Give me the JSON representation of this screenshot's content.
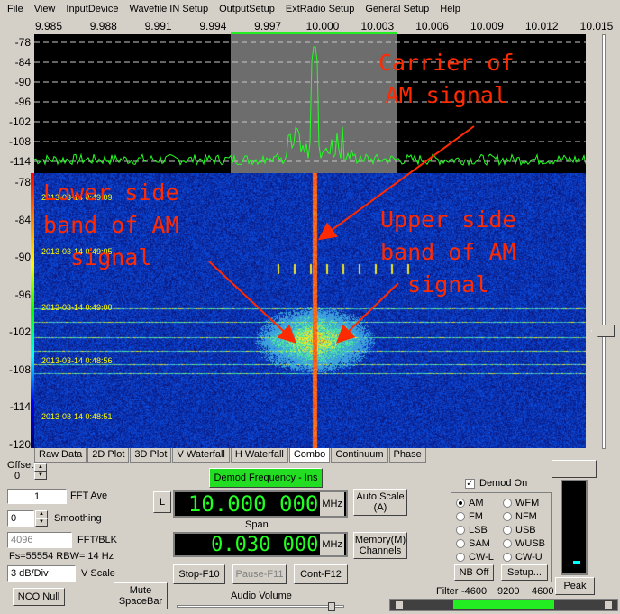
{
  "menu": [
    "File",
    "View",
    "InputDevice",
    "Wavefile IN Setup",
    "OutputSetup",
    "ExtRadio Setup",
    "General Setup",
    "Help"
  ],
  "freq_axis": [
    "9.985",
    "9.988",
    "9.991",
    "9.994",
    "9.997",
    "10.000",
    "10.003",
    "10.006",
    "10.009",
    "10.012",
    "10.015"
  ],
  "spectrum_db_axis": [
    "-78",
    "-84",
    "-90",
    "-96",
    "-102",
    "-108",
    "-114"
  ],
  "waterfall_db_axis": [
    "-78",
    "-84",
    "-90",
    "-96",
    "-102",
    "-108",
    "-114",
    "-120"
  ],
  "timestamps": [
    "2013-03-14 0:49:09",
    "2013-03-14 0:49:05",
    "2013-03-14 0:49:00",
    "2013-03-14 0:48:56",
    "2013-03-14 0:48:51"
  ],
  "annotations": {
    "carrier": "Carrier of\nAM signal",
    "lower": "Lower side\nband of AM\nsignal",
    "upper": "Upper side\nband of AM\nsignal"
  },
  "tabs": [
    "Raw Data",
    "2D Plot",
    "3D Plot",
    "V Waterfall",
    "H Waterfall",
    "Combo",
    "Continuum",
    "Phase"
  ],
  "active_tab": "Combo",
  "controls": {
    "offset_label": "Offset",
    "offset_value": "0",
    "fft_ave_value": "1",
    "fft_ave_label": "FFT Ave",
    "smoothing_value": "0",
    "smoothing_label": "Smoothing",
    "fft_blk_value": "4096",
    "fft_blk_label": "FFT/BLK",
    "fs_info": "Fs=55554 RBW= 14 Hz",
    "vscale_value": "3 dB/Div",
    "vscale_label": "V Scale",
    "nco_null": "NCO Null",
    "mute": "Mute\nSpaceBar",
    "demod_freq_button": "Demod Frequency - Ins",
    "l_button": "L",
    "demod_freq": "10.000 000",
    "freq_unit": "MHz",
    "auto_scale": "Auto Scale\n(A)",
    "span_label": "Span",
    "span_value": "0.030 000",
    "span_unit": "MHz",
    "memory": "Memory(M)\nChannels",
    "stop": "Stop-F10",
    "pause": "Pause-F11",
    "cont": "Cont-F12",
    "audio_volume": "Audio Volume",
    "demod_on": "Demod On",
    "demod_on_checked": "✓",
    "modes": [
      "AM",
      "WFM",
      "FM",
      "NFM",
      "LSB",
      "USB",
      "SAM",
      "WUSB",
      "CW-L",
      "CW-U"
    ],
    "selected_mode": "AM",
    "nb_off": "NB Off",
    "setup": "Setup...",
    "peak": "Peak",
    "filter_label": "Filter",
    "filter_low": "-4600",
    "filter_width": "9200",
    "filter_high": "4600"
  },
  "colors": {
    "grid": "#c8c8c8",
    "trace": "#22ff22",
    "annotation": "#ff2a00",
    "passband": "#808080",
    "demod_button": "#22dd22"
  }
}
